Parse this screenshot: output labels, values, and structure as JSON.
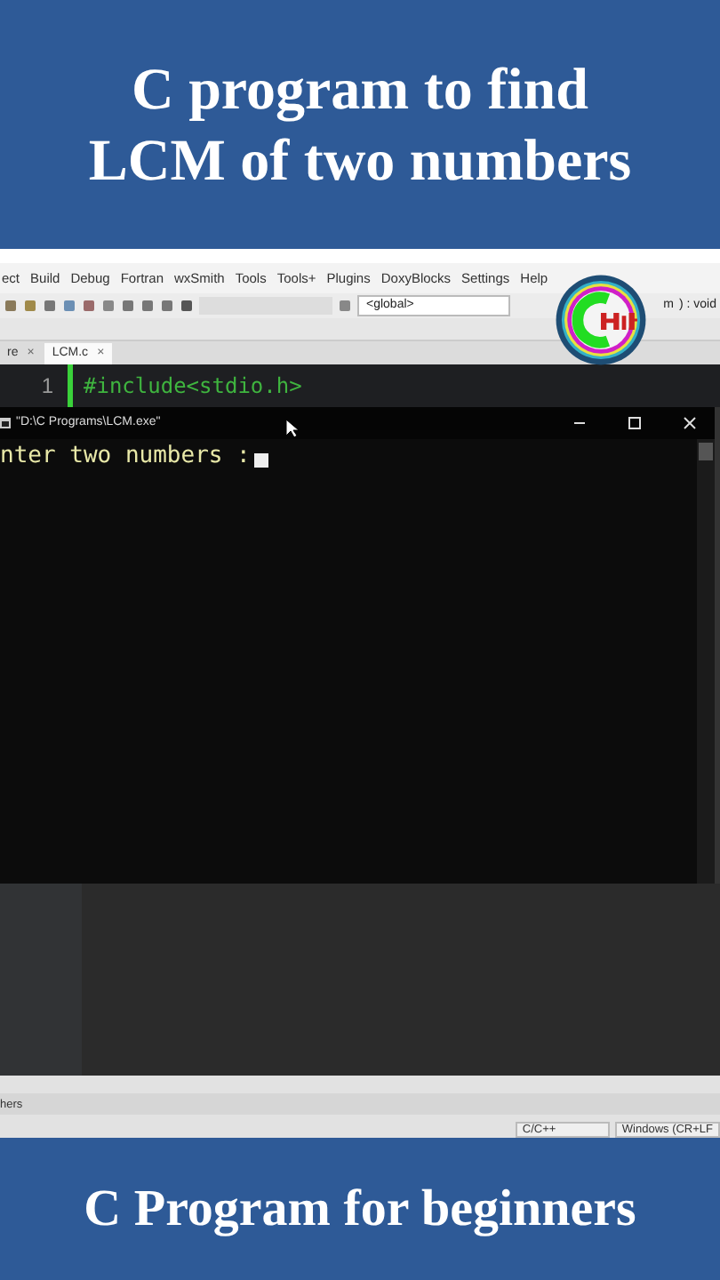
{
  "top_banner": {
    "title_lines": [
      "C program to find",
      "LCM of two numbers"
    ]
  },
  "ide": {
    "menu": [
      "ect",
      "Build",
      "Debug",
      "Fortran",
      "wxSmith",
      "Tools",
      "Tools+",
      "Plugins",
      "DoxyBlocks",
      "Settings",
      "Help"
    ],
    "scope_dropdown": "<global>",
    "function_dropdown": [
      "m",
      ") : void"
    ],
    "tabs": [
      {
        "label": "re",
        "close": "×",
        "selected": false
      },
      {
        "label": "LCM.c",
        "close": "×",
        "selected": true
      }
    ],
    "editor": {
      "lines": [
        {
          "number": "1",
          "code": "#include<stdio.h>"
        }
      ]
    },
    "console": {
      "title": "\"D:\\C Programs\\LCM.exe\"",
      "output": "nter two numbers :"
    },
    "bottom_panel": {
      "tab": "hers"
    },
    "status_bar": [
      "C/C++",
      "Windows (CR+LF"
    ]
  },
  "bottom_banner": {
    "title": "C Program for beginners"
  }
}
